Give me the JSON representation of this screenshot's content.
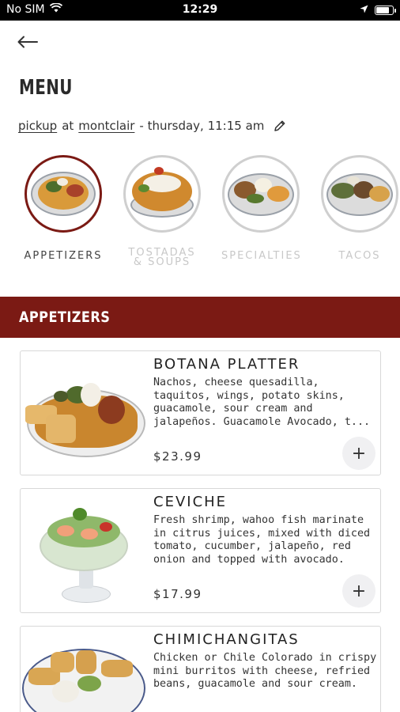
{
  "status": {
    "carrier": "No SIM",
    "time": "12:29",
    "battery_level": 0.85
  },
  "header": {
    "title": "MENU"
  },
  "order": {
    "mode": "pickup",
    "connector": "at",
    "location": "montclair",
    "time": "- thursday, 11:15 am"
  },
  "categories": [
    {
      "label": "APPETIZERS",
      "active": true
    },
    {
      "label": "TOSTADAS & SOUPS",
      "active": false
    },
    {
      "label": "SPECIALTIES",
      "active": false
    },
    {
      "label": "TACOS",
      "active": false
    }
  ],
  "section": {
    "title": "APPETIZERS"
  },
  "items": [
    {
      "name": "BOTANA PLATTER",
      "description": "Nachos, cheese quesadilla, taquitos, wings, potato skins, guacamole, sour cream and jalapeños. Guacamole Avocado, t...",
      "price": "$23.99",
      "add": "+"
    },
    {
      "name": "CEVICHE",
      "description": "Fresh shrimp, wahoo fish marinate in citrus juices, mixed with diced tomato, cucumber, jalapeño, red onion and topped with avocado.",
      "price": "$17.99",
      "add": "+"
    },
    {
      "name": "CHIMICHANGITAS",
      "description": "Chicken or Chile Colorado in crispy mini burritos with cheese, refried beans, guacamole and sour cream.",
      "price": "",
      "add": "+"
    }
  ],
  "colors": {
    "accent": "#7b1a14",
    "inactive_circle": "#cfcfcf"
  }
}
